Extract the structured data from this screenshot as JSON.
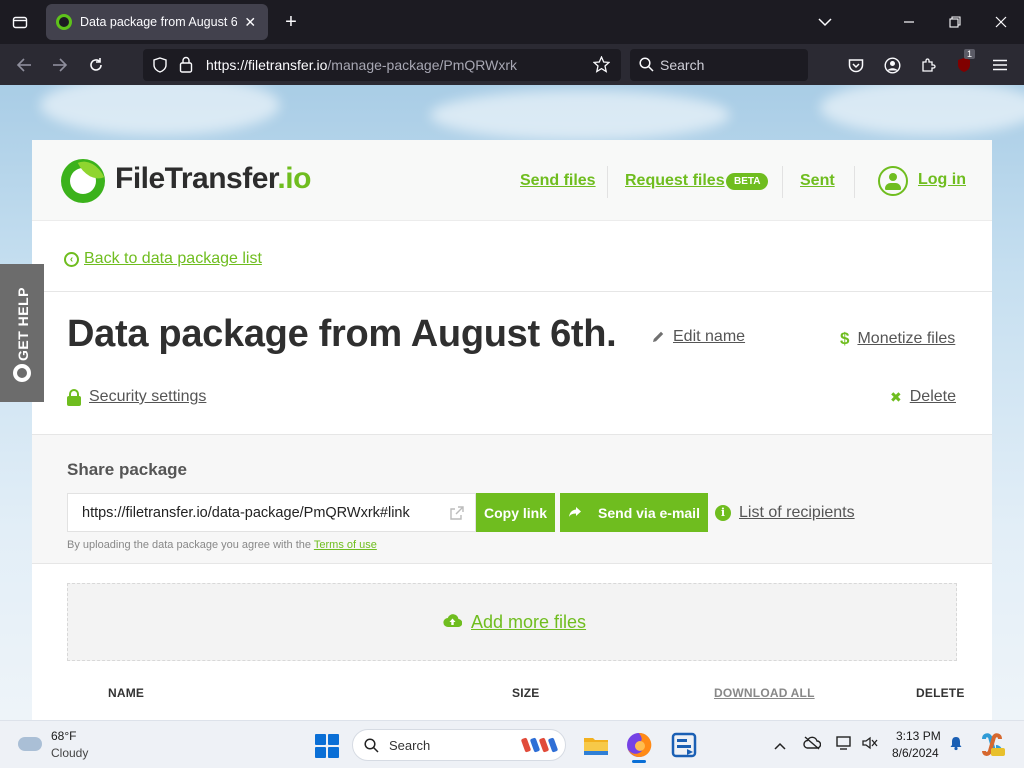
{
  "browser": {
    "tab_title": "Data package from August 6th.",
    "tab_close": "✕",
    "url_host": "https://filetransfer.io",
    "url_path": "/manage-package/PmQRWxrk",
    "search_placeholder": "Search",
    "extension_badge": "1"
  },
  "header": {
    "logo_main": "FileTransfer",
    "logo_suffix": ".io",
    "nav": {
      "send_files": "Send files",
      "request_files": "Request files",
      "beta_badge": "BETA",
      "sent": "Sent",
      "log_in": "Log in"
    }
  },
  "package": {
    "back_link": "Back to data package list",
    "title": "Data package from August 6th.",
    "edit_name": "Edit name",
    "monetize": "Monetize files",
    "security_settings": "Security settings",
    "delete": "Delete"
  },
  "share": {
    "title": "Share package",
    "link": "https://filetransfer.io/data-package/PmQRWxrk#link",
    "copy_link": "Copy link",
    "send_email": "Send via e-mail",
    "recipients": "List of recipients",
    "terms_prefix": "By uploading the data package you agree with the",
    "terms_link": "Terms of use"
  },
  "files": {
    "add_more": "Add more files",
    "columns": {
      "name": "NAME",
      "size": "SIZE",
      "download_all": "DOWNLOAD ALL",
      "delete": "DELETE"
    }
  },
  "side_tab": {
    "label": "GET HELP"
  },
  "taskbar": {
    "weather_temp": "68°F",
    "weather_desc": "Cloudy",
    "search_placeholder": "Search",
    "time": "3:13 PM",
    "date": "8/6/2024"
  },
  "colors": {
    "brand_green": "#6fbd1f",
    "browser_dark": "#1c1b22",
    "toolbar": "#2b2a33"
  }
}
